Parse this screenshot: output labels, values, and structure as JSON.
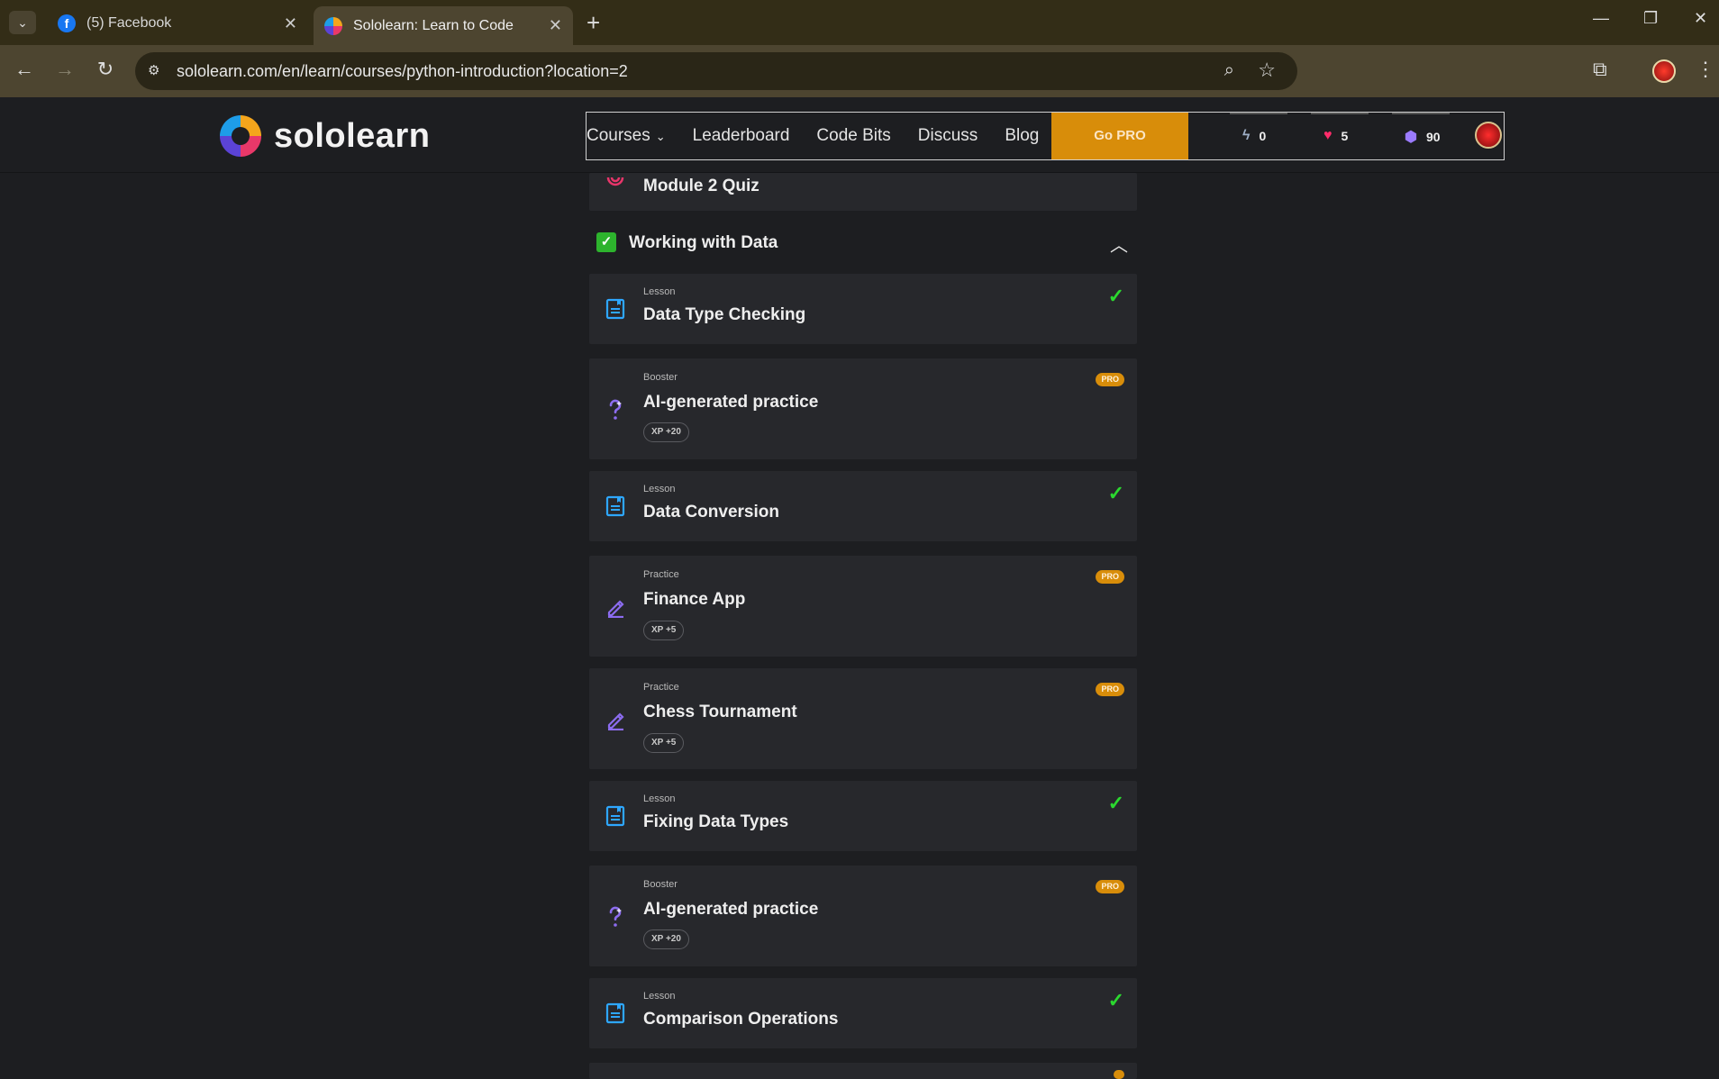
{
  "browser": {
    "tabs": [
      {
        "label": "(5) Facebook",
        "icon": "facebook-icon"
      },
      {
        "label": "Sololearn: Learn to Code",
        "icon": "sololearn-icon"
      }
    ],
    "url": "sololearn.com/en/learn/courses/python-introduction?location=2"
  },
  "header": {
    "logo_text": "sololearn",
    "nav": {
      "courses": "Courses",
      "leaderboard": "Leaderboard",
      "code_bits": "Code Bits",
      "discuss": "Discuss",
      "blog": "Blog",
      "go_pro": "Go PRO"
    },
    "stats": {
      "streak": "0",
      "hearts": "5",
      "gems": "90"
    }
  },
  "course": {
    "prev_item_title": "Module 2 Quiz",
    "section_title": "Working with Data",
    "items": [
      {
        "kind": "Lesson",
        "title": "Data Type Checking",
        "status": "done"
      },
      {
        "kind": "Booster",
        "title": "AI-generated practice",
        "badge": "PRO",
        "xp": "XP +20"
      },
      {
        "kind": "Lesson",
        "title": "Data Conversion",
        "status": "done"
      },
      {
        "kind": "Practice",
        "title": "Finance App",
        "badge": "PRO",
        "xp": "XP +5"
      },
      {
        "kind": "Practice",
        "title": "Chess Tournament",
        "badge": "PRO",
        "xp": "XP +5"
      },
      {
        "kind": "Lesson",
        "title": "Fixing Data Types",
        "status": "done"
      },
      {
        "kind": "Booster",
        "title": "AI-generated practice",
        "badge": "PRO",
        "xp": "XP +20"
      },
      {
        "kind": "Lesson",
        "title": "Comparison Operations",
        "status": "done"
      }
    ]
  },
  "colors": {
    "pro": "#d88d0a",
    "check": "#2bd82f",
    "lesson_icon": "#2ea7ff",
    "practice_icon": "#8c6cf0"
  }
}
